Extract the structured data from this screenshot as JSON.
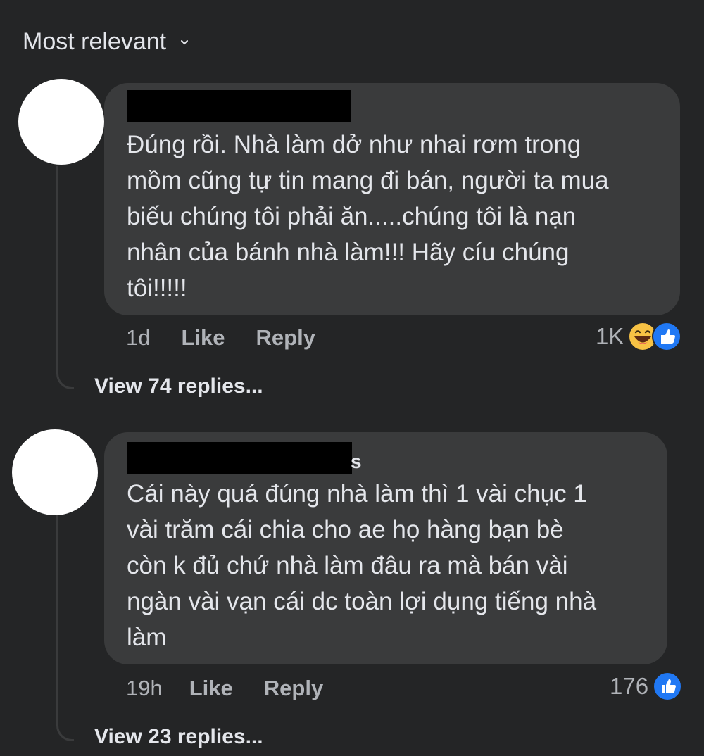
{
  "sort": {
    "label": "Most relevant"
  },
  "comments": [
    {
      "name_visible_suffix": "",
      "text": "Đúng rồi. Nhà làm dở như nhai rơm trong\nmồm cũng tự tin mang đi bán, người ta mua\nbiếu chúng tôi phải ăn.....chúng tôi là nạn\nnhân của bánh nhà làm!!! Hãy cíu chúng\ntôi!!!!!",
      "time": "1d",
      "like_label": "Like",
      "reply_label": "Reply",
      "reaction_count": "1K",
      "reactions": [
        "haha-emoji-icon",
        "like-emoji-icon"
      ],
      "view_replies": "View 74 replies..."
    },
    {
      "name_visible_suffix": "s",
      "text": "Cái này quá đúng nhà làm thì 1 vài chục 1\nvài trăm cái chia cho ae họ hàng bạn bè\ncòn k đủ chứ nhà làm đâu ra mà bán vài\nngàn vài vạn cái dc toàn lợi dụng tiếng nhà\nlàm",
      "time": "19h",
      "like_label": "Like",
      "reply_label": "Reply",
      "reaction_count": "176",
      "reactions": [
        "like-emoji-icon"
      ],
      "view_replies": "View 23 replies..."
    }
  ],
  "colors": {
    "background": "#242526",
    "bubble": "#3a3b3c",
    "like_blue": "#2078f4",
    "haha_yellow": "#f7c244"
  }
}
